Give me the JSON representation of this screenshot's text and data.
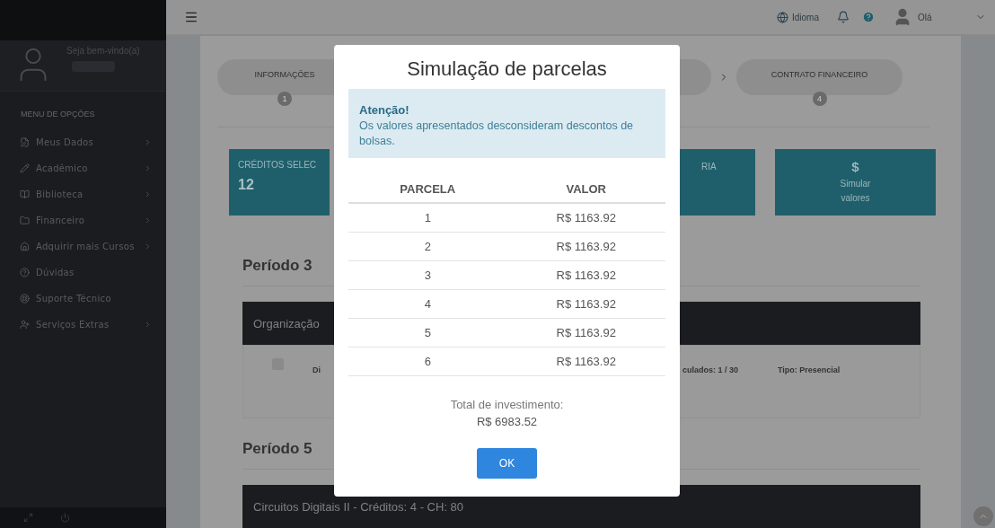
{
  "topbar": {
    "language": "Idioma",
    "greeting": "Olá"
  },
  "sidebar": {
    "welcome": "Seja bem-vindo(a)",
    "menu_title": "MENU DE OPÇÕES",
    "items": [
      {
        "label": "Meus Dados",
        "kind": "edit",
        "submenu": true
      },
      {
        "label": "Acadêmico",
        "kind": "pencil",
        "submenu": true
      },
      {
        "label": "Biblioteca",
        "kind": "book",
        "submenu": true
      },
      {
        "label": "Financeiro",
        "kind": "folder",
        "submenu": true
      },
      {
        "label": "Adquirir mais Cursos",
        "kind": "home",
        "submenu": true
      },
      {
        "label": "Dúvidas",
        "kind": "help",
        "submenu": false
      },
      {
        "label": "Suporte Técnico",
        "kind": "support",
        "submenu": false
      },
      {
        "label": "Serviços Extras",
        "kind": "user-plus",
        "submenu": true
      }
    ]
  },
  "steps": [
    {
      "label": "INFORMAÇÕES",
      "number": "1"
    },
    {
      "label": "CONTRATO FINANCEIRO",
      "number": "4"
    }
  ],
  "cards": [
    {
      "kind": "value",
      "label": "CRÉDITOS SELEC",
      "value": "12"
    },
    {
      "kind": "label",
      "label": "RIA"
    },
    {
      "kind": "action",
      "symbol": "$",
      "label": "Simular valores"
    }
  ],
  "periods": [
    {
      "title": "Período 3",
      "course": "Organização",
      "row": {
        "checked": false,
        "name": "Di",
        "enrolled": "culados: 1 / 30",
        "type": "Tipo: Presencial"
      }
    },
    {
      "title": "Período 5",
      "course": "Circuitos Digitais II - Créditos: 4 - CH: 80"
    }
  ],
  "modal": {
    "title": "Simulação de parcelas",
    "alert_title": "Atenção!",
    "alert_text": "Os valores apresentados desconsideram descontos de bolsas.",
    "columns": [
      "PARCELA",
      "VALOR"
    ],
    "rows": [
      [
        "1",
        "R$ 1163.92"
      ],
      [
        "2",
        "R$ 1163.92"
      ],
      [
        "3",
        "R$ 1163.92"
      ],
      [
        "4",
        "R$ 1163.92"
      ],
      [
        "5",
        "R$ 1163.92"
      ],
      [
        "6",
        "R$ 1163.92"
      ]
    ],
    "total_label": "Total de investimento:",
    "total_value": "R$ 6983.52",
    "button": "OK"
  }
}
